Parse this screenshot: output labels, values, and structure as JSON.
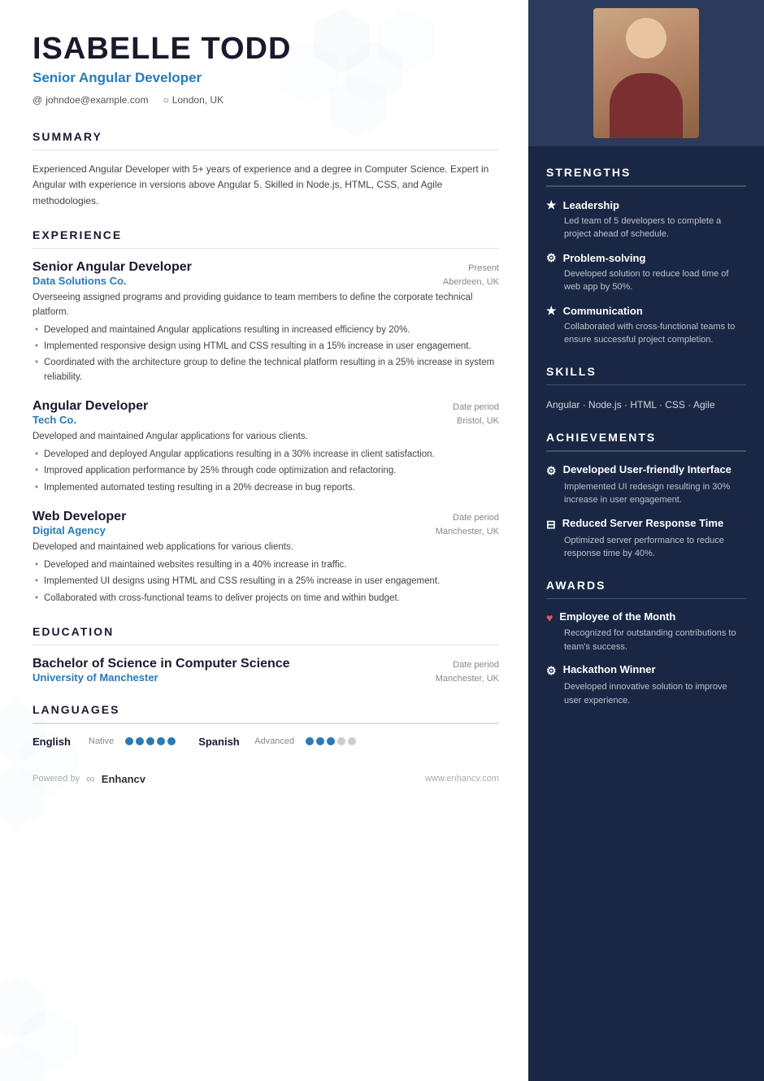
{
  "header": {
    "name": "ISABELLE TODD",
    "job_title": "Senior Angular Developer",
    "email": "johndoe@example.com",
    "location": "London, UK"
  },
  "summary": {
    "title": "SUMMARY",
    "text": "Experienced Angular Developer with 5+ years of experience and a degree in Computer Science. Expert in Angular with experience in versions above Angular 5. Skilled in Node.js, HTML, CSS, and Agile methodologies."
  },
  "experience": {
    "title": "EXPERIENCE",
    "jobs": [
      {
        "title": "Senior Angular Developer",
        "company": "Data Solutions Co.",
        "date": "Present",
        "location": "Aberdeen, UK",
        "desc": "Overseeing assigned programs and providing guidance to team members to define the corporate technical platform.",
        "bullets": [
          "Developed and maintained Angular applications resulting in increased efficiency by 20%.",
          "Implemented responsive design using HTML and CSS resulting in a 15% increase in user engagement.",
          "Coordinated with the architecture group to define the technical platform resulting in a 25% increase in system reliability."
        ]
      },
      {
        "title": "Angular Developer",
        "company": "Tech Co.",
        "date": "Date period",
        "location": "Bristol, UK",
        "desc": "Developed and maintained Angular applications for various clients.",
        "bullets": [
          "Developed and deployed Angular applications resulting in a 30% increase in client satisfaction.",
          "Improved application performance by 25% through code optimization and refactoring.",
          "Implemented automated testing resulting in a 20% decrease in bug reports."
        ]
      },
      {
        "title": "Web Developer",
        "company": "Digital Agency",
        "date": "Date period",
        "location": "Manchester, UK",
        "desc": "Developed and maintained web applications for various clients.",
        "bullets": [
          "Developed and maintained websites resulting in a 40% increase in traffic.",
          "Implemented UI designs using HTML and CSS resulting in a 25% increase in user engagement.",
          "Collaborated with cross-functional teams to deliver projects on time and within budget."
        ]
      }
    ]
  },
  "education": {
    "title": "EDUCATION",
    "degree": "Bachelor of Science in Computer Science",
    "school": "University of Manchester",
    "date": "Date period",
    "location": "Manchester, UK"
  },
  "languages": {
    "title": "LANGUAGES",
    "items": [
      {
        "name": "English",
        "level": "Native",
        "filled": 5,
        "total": 5
      },
      {
        "name": "Spanish",
        "level": "Advanced",
        "filled": 3,
        "total": 5
      }
    ]
  },
  "footer": {
    "powered_by": "Powered by",
    "brand": "Enhancv",
    "url": "www.enhancv.com"
  },
  "sidebar": {
    "strengths": {
      "title": "STRENGTHS",
      "items": [
        {
          "icon": "★",
          "name": "Leadership",
          "desc": "Led team of 5 developers to complete a project ahead of schedule."
        },
        {
          "icon": "⚙",
          "name": "Problem-solving",
          "desc": "Developed solution to reduce load time of web app by 50%."
        },
        {
          "icon": "★",
          "name": "Communication",
          "desc": "Collaborated with cross-functional teams to ensure successful project completion."
        }
      ]
    },
    "skills": {
      "title": "SKILLS",
      "text": "Angular · Node.js · HTML · CSS · Agile"
    },
    "achievements": {
      "title": "ACHIEVEMENTS",
      "items": [
        {
          "icon": "⚙",
          "name": "Developed User-friendly Interface",
          "desc": "Implemented UI redesign resulting in 30% increase in user engagement."
        },
        {
          "icon": "⊟",
          "name": "Reduced Server Response Time",
          "desc": "Optimized server performance to reduce response time by 40%."
        }
      ]
    },
    "awards": {
      "title": "AWARDS",
      "items": [
        {
          "icon": "♥",
          "name": "Employee of the Month",
          "desc": "Recognized for outstanding contributions to team's success."
        },
        {
          "icon": "⚙",
          "name": "Hackathon Winner",
          "desc": "Developed innovative solution to improve user experience."
        }
      ]
    }
  }
}
